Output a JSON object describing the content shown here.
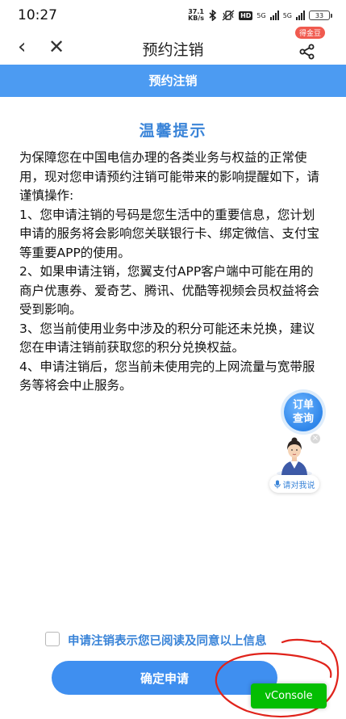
{
  "status_bar": {
    "time": "10:27",
    "net_speed_value": "37.1",
    "net_speed_unit": "KB/s",
    "hd_label": "HD",
    "signal_1": "5G",
    "signal_2": "5G",
    "battery_level": "33"
  },
  "nav": {
    "back_icon": "‹",
    "close_icon": "✕",
    "title": "预约注销",
    "coin_badge": "得金豆",
    "share_icon": "share-icon"
  },
  "header": {
    "title": "预约注销"
  },
  "notice": {
    "title": "温馨提示",
    "paragraphs": [
      "为保障您在中国电信办理的各类业务与权益的正常使用，现对您申请预约注销可能带来的影响提醒如下，请谨慎操作:",
      "1、您申请注销的号码是您生活中的重要信息，您计划申请的服务将会影响您关联银行卡、绑定微信、支付宝等重要APP的使用。",
      "2、如果申请注销，您翼支付APP客户端中可能在用的商户优惠券、爱奇艺、腾讯、优酷等视频会员权益将会受到影响。",
      "3、您当前使用业务中涉及的积分可能还未兑换，建议您在申请注销前获取您的积分兑换权益。",
      "4、申请注销后，您当前未使用完的上网流量与宽带服务等将会中止服务。"
    ]
  },
  "float": {
    "order_line1": "订单",
    "order_line2": "查询",
    "close": "×",
    "talk": "请对我说"
  },
  "agreement": {
    "text": "申请注销表示您已阅读及同意以上信息",
    "checked": false
  },
  "actions": {
    "confirm": "确定申请",
    "vconsole": "vConsole"
  },
  "colors": {
    "header_blue": "#4c9bf2",
    "accent_blue": "#3a84d8",
    "button_blue": "#3f8ff0",
    "vconsole_green": "#04be02",
    "annotation_red": "#e0231b"
  }
}
